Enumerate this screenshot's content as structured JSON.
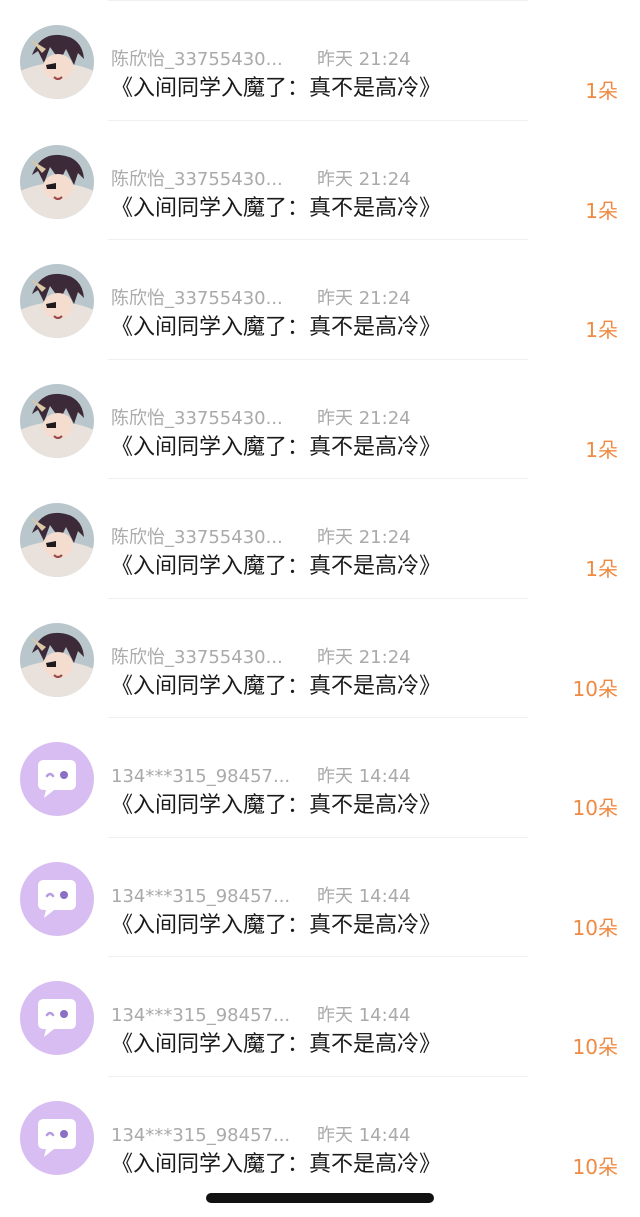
{
  "colors": {
    "accent": "#f08a43",
    "meta_text": "#aaaaaa",
    "title_text": "#1b1b1b",
    "purple_avatar": "#d8bdf2"
  },
  "list": [
    {
      "avatar": "anime-avatar-icon",
      "name": "陈欣怡_33755430...",
      "time": "昨天 21:24",
      "title": "《入间同学入魔了：真不是高冷》",
      "count": "1朵"
    },
    {
      "avatar": "anime-avatar-icon",
      "name": "陈欣怡_33755430...",
      "time": "昨天 21:24",
      "title": "《入间同学入魔了：真不是高冷》",
      "count": "1朵"
    },
    {
      "avatar": "anime-avatar-icon",
      "name": "陈欣怡_33755430...",
      "time": "昨天 21:24",
      "title": "《入间同学入魔了：真不是高冷》",
      "count": "1朵"
    },
    {
      "avatar": "anime-avatar-icon",
      "name": "陈欣怡_33755430...",
      "time": "昨天 21:24",
      "title": "《入间同学入魔了：真不是高冷》",
      "count": "1朵"
    },
    {
      "avatar": "anime-avatar-icon",
      "name": "陈欣怡_33755430...",
      "time": "昨天 21:24",
      "title": "《入间同学入魔了：真不是高冷》",
      "count": "1朵"
    },
    {
      "avatar": "anime-avatar-icon",
      "name": "陈欣怡_33755430...",
      "time": "昨天 21:24",
      "title": "《入间同学入魔了：真不是高冷》",
      "count": "10朵"
    },
    {
      "avatar": "chat-bubble-avatar-icon",
      "name": "134***315_98457...",
      "time": "昨天 14:44",
      "title": "《入间同学入魔了：真不是高冷》",
      "count": "10朵"
    },
    {
      "avatar": "chat-bubble-avatar-icon",
      "name": "134***315_98457...",
      "time": "昨天 14:44",
      "title": "《入间同学入魔了：真不是高冷》",
      "count": "10朵"
    },
    {
      "avatar": "chat-bubble-avatar-icon",
      "name": "134***315_98457...",
      "time": "昨天 14:44",
      "title": "《入间同学入魔了：真不是高冷》",
      "count": "10朵"
    },
    {
      "avatar": "chat-bubble-avatar-icon",
      "name": "134***315_98457...",
      "time": "昨天 14:44",
      "title": "《入间同学入魔了：真不是高冷》",
      "count": "10朵"
    }
  ]
}
